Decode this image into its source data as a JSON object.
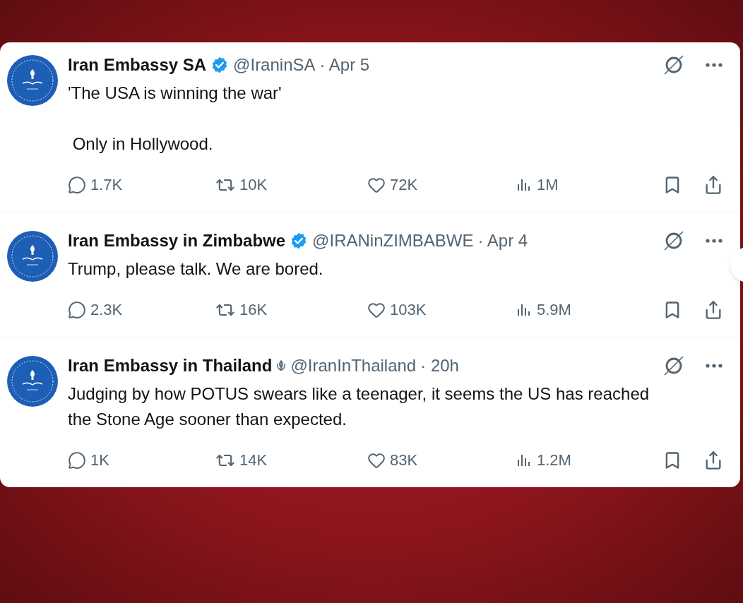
{
  "tweets": [
    {
      "name": "Iran Embassy SA",
      "verified": true,
      "emblem": false,
      "handle": "@IraninSA",
      "time": "· Apr 5",
      "paragraphs": [
        "'The USA is winning the war'",
        " Only in Hollywood."
      ],
      "replies": "1.7K",
      "reposts": "10K",
      "likes": "72K",
      "views": "1M"
    },
    {
      "name": "Iran Embassy in Zimbabwe",
      "verified": true,
      "emblem": false,
      "handle": "@IRANinZIMBABWE",
      "time": "· Apr 4",
      "paragraphs": [
        "Trump, please talk. We are bored."
      ],
      "replies": "2.3K",
      "reposts": "16K",
      "likes": "103K",
      "views": "5.9M"
    },
    {
      "name": "Iran Embassy in Thailand",
      "verified": false,
      "emblem": true,
      "handle": "@IranInThailand",
      "time": "· 20h",
      "paragraphs": [
        "Judging by how POTUS swears like a teenager, it seems the US has reached the Stone Age sooner than expected."
      ],
      "replies": "1K",
      "reposts": "14K",
      "likes": "83K",
      "views": "1.2M"
    }
  ]
}
